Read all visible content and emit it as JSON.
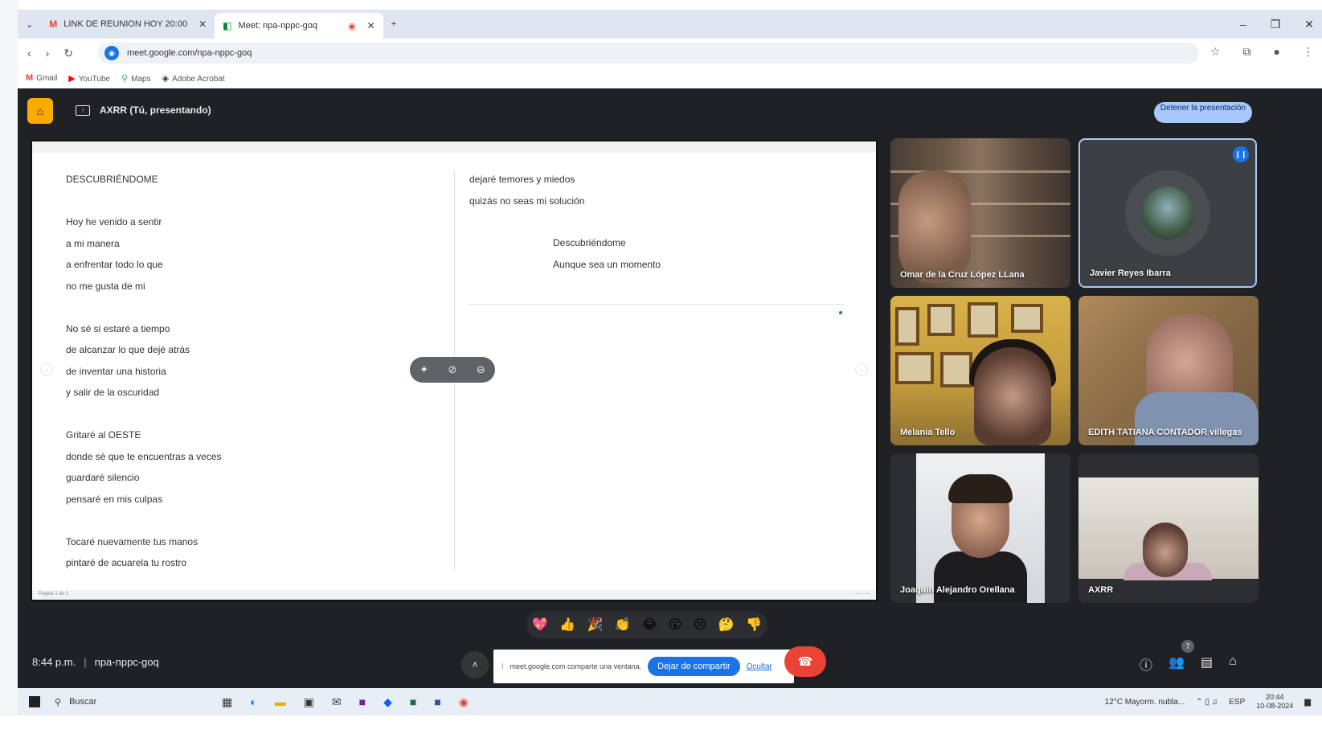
{
  "browser": {
    "tabs": [
      {
        "icon": "M",
        "label": "LINK DE REUNION HOY 20:00"
      },
      {
        "icon": "◧",
        "label": "Meet: npa-nppc-goq"
      }
    ],
    "new_tab": "+",
    "url": "meet.google.com/npa-nppc-goq",
    "bookmarks": [
      {
        "icon": "M",
        "label": "Gmail"
      },
      {
        "icon": "▶",
        "label": "YouTube"
      },
      {
        "icon": "⚲",
        "label": "Maps"
      },
      {
        "icon": "◈",
        "label": "Adobe Acrobat"
      }
    ]
  },
  "meet": {
    "presenting_title": "AXRR (Tú, presentando)",
    "stop_presenting": "Detener la presentación",
    "time": "8:44 p.m.",
    "meeting_code": "npa-nppc-goq",
    "participant_count": "7",
    "share_notice": {
      "text": "meet.google.com comparte una ventana.",
      "stop_button": "Dejar de compartir",
      "hide_link": "Ocultar"
    },
    "reactions": [
      "💖",
      "👍",
      "🎉",
      "👏",
      "😂",
      "😮",
      "😢",
      "🤔",
      "👎"
    ],
    "participants": [
      {
        "name": "Omar de la Cruz López LLana"
      },
      {
        "name": "Javier Reyes Ibarra"
      },
      {
        "name": "Melania Tello"
      },
      {
        "name": "EDITH TATIANA CONTADOR villegas"
      },
      {
        "name": "Joaquín Alejandro Orellana"
      },
      {
        "name": "AXRR"
      }
    ]
  },
  "document": {
    "left_column": [
      "DESCUBRIÉNDOME",
      "",
      "Hoy he venido a sentir",
      "a mi manera",
      "a enfrentar todo lo que",
      "no me gusta de mi",
      "",
      "No sé si estaré a tiempo",
      "de alcanzar lo que dejé atrás",
      "de inventar una historia",
      "y salir de la oscuridad",
      "",
      "Gritaré al OESTE",
      "donde sé que te encuentras a veces",
      "guardaré silencio",
      "pensaré en mis culpas",
      "",
      "Tocaré nuevamente tus manos",
      "pintaré de acuarela tu rostro"
    ],
    "right_column_top": [
      "dejaré temores y miedos",
      "quizás no seas mi solución"
    ],
    "right_column_indent": [
      "Descubriéndome",
      "Aunque sea un momento"
    ],
    "footer_left": "Página 1 de 1"
  },
  "taskbar": {
    "search": "Buscar",
    "weather": "12°C Mayorm. nubla...",
    "lang": "ESP",
    "clock_time": "20:44",
    "clock_date": "10-08-2024"
  }
}
